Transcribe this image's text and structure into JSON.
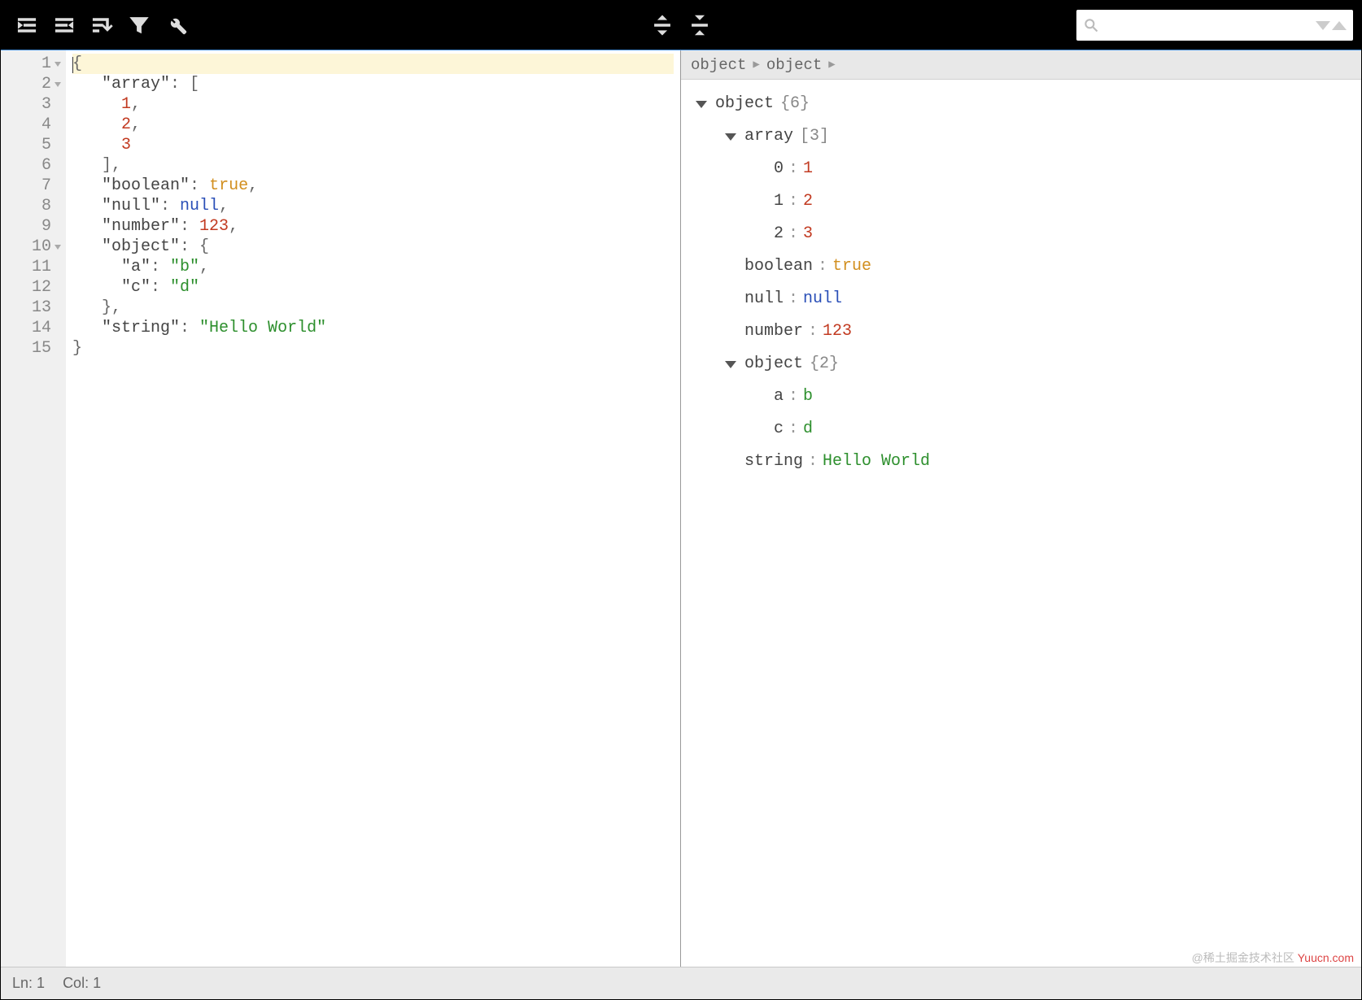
{
  "toolbar": {
    "left_icons": [
      "indent-right-icon",
      "indent-left-icon",
      "sort-icon",
      "filter-icon",
      "wrench-icon"
    ],
    "center_icons": [
      "expand-vertical-icon",
      "collapse-vertical-icon"
    ],
    "search_placeholder": ""
  },
  "editor": {
    "lines": [
      {
        "n": 1,
        "fold": true,
        "hl": true,
        "tokens": [
          [
            "k",
            "{"
          ]
        ]
      },
      {
        "n": 2,
        "fold": true,
        "hl": false,
        "tokens": [
          [
            "k",
            "   "
          ],
          [
            "pkey",
            "\"array\""
          ],
          [
            "k",
            ": ["
          ]
        ]
      },
      {
        "n": 3,
        "fold": false,
        "hl": false,
        "tokens": [
          [
            "k",
            "     "
          ],
          [
            "num",
            "1"
          ],
          [
            "k",
            ","
          ]
        ]
      },
      {
        "n": 4,
        "fold": false,
        "hl": false,
        "tokens": [
          [
            "k",
            "     "
          ],
          [
            "num",
            "2"
          ],
          [
            "k",
            ","
          ]
        ]
      },
      {
        "n": 5,
        "fold": false,
        "hl": false,
        "tokens": [
          [
            "k",
            "     "
          ],
          [
            "num",
            "3"
          ]
        ]
      },
      {
        "n": 6,
        "fold": false,
        "hl": false,
        "tokens": [
          [
            "k",
            "   ],"
          ]
        ]
      },
      {
        "n": 7,
        "fold": false,
        "hl": false,
        "tokens": [
          [
            "k",
            "   "
          ],
          [
            "pkey",
            "\"boolean\""
          ],
          [
            "k",
            ": "
          ],
          [
            "bool",
            "true"
          ],
          [
            "k",
            ","
          ]
        ]
      },
      {
        "n": 8,
        "fold": false,
        "hl": false,
        "tokens": [
          [
            "k",
            "   "
          ],
          [
            "pkey",
            "\"null\""
          ],
          [
            "k",
            ": "
          ],
          [
            "nul",
            "null"
          ],
          [
            "k",
            ","
          ]
        ]
      },
      {
        "n": 9,
        "fold": false,
        "hl": false,
        "tokens": [
          [
            "k",
            "   "
          ],
          [
            "pkey",
            "\"number\""
          ],
          [
            "k",
            ": "
          ],
          [
            "num",
            "123"
          ],
          [
            "k",
            ","
          ]
        ]
      },
      {
        "n": 10,
        "fold": true,
        "hl": false,
        "tokens": [
          [
            "k",
            "   "
          ],
          [
            "pkey",
            "\"object\""
          ],
          [
            "k",
            ": {"
          ]
        ]
      },
      {
        "n": 11,
        "fold": false,
        "hl": false,
        "tokens": [
          [
            "k",
            "     "
          ],
          [
            "pkey",
            "\"a\""
          ],
          [
            "k",
            ": "
          ],
          [
            "str",
            "\"b\""
          ],
          [
            "k",
            ","
          ]
        ]
      },
      {
        "n": 12,
        "fold": false,
        "hl": false,
        "tokens": [
          [
            "k",
            "     "
          ],
          [
            "pkey",
            "\"c\""
          ],
          [
            "k",
            ": "
          ],
          [
            "str",
            "\"d\""
          ]
        ]
      },
      {
        "n": 13,
        "fold": false,
        "hl": false,
        "tokens": [
          [
            "k",
            "   },"
          ]
        ]
      },
      {
        "n": 14,
        "fold": false,
        "hl": false,
        "tokens": [
          [
            "k",
            "   "
          ],
          [
            "pkey",
            "\"string\""
          ],
          [
            "k",
            ": "
          ],
          [
            "str",
            "\"Hello World\""
          ]
        ]
      },
      {
        "n": 15,
        "fold": false,
        "hl": false,
        "tokens": [
          [
            "k",
            "}"
          ]
        ]
      }
    ]
  },
  "breadcrumb": [
    "object",
    "object"
  ],
  "tree": [
    {
      "depth": 0,
      "disc": true,
      "key": "object",
      "meta": "{6}"
    },
    {
      "depth": 1,
      "disc": true,
      "key": "array",
      "meta": "[3]"
    },
    {
      "depth": 2,
      "disc": false,
      "key": "0",
      "val": "1",
      "vclass": "tval-num"
    },
    {
      "depth": 2,
      "disc": false,
      "key": "1",
      "val": "2",
      "vclass": "tval-num"
    },
    {
      "depth": 2,
      "disc": false,
      "key": "2",
      "val": "3",
      "vclass": "tval-num"
    },
    {
      "depth": 1,
      "disc": false,
      "key": "boolean",
      "val": "true",
      "vclass": "tval-bool"
    },
    {
      "depth": 1,
      "disc": false,
      "key": "null",
      "val": "null",
      "vclass": "tval-null"
    },
    {
      "depth": 1,
      "disc": false,
      "key": "number",
      "val": "123",
      "vclass": "tval-num"
    },
    {
      "depth": 1,
      "disc": true,
      "key": "object",
      "meta": "{2}"
    },
    {
      "depth": 2,
      "disc": false,
      "key": "a",
      "keypad": "a  ",
      "val": "b",
      "vclass": "tval-str"
    },
    {
      "depth": 2,
      "disc": false,
      "key": "c",
      "keypad": "c  ",
      "val": "d",
      "vclass": "tval-str"
    },
    {
      "depth": 1,
      "disc": false,
      "key": "string",
      "val": "Hello World",
      "vclass": "tval-str"
    }
  ],
  "status": {
    "ln_label": "Ln:",
    "ln": "1",
    "col_label": "Col:",
    "col": "1"
  },
  "watermark": {
    "gray": "@稀土掘金技术社区",
    "red": "Yuucn.com"
  }
}
